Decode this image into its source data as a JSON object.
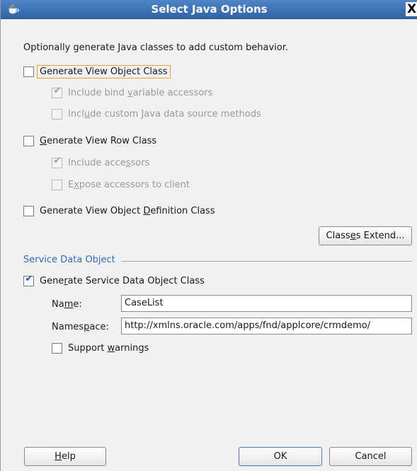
{
  "window": {
    "title": "Select Java Options",
    "close_glyph": "X",
    "icon": "java-cup-icon"
  },
  "intro": "Optionally generate Java classes to add custom behavior.",
  "view_object_class": {
    "label_pre": "Generate View Ob",
    "label_key": "j",
    "label_post": "ect Class",
    "checked": false
  },
  "bind_accessors": {
    "label_pre": "Include bind ",
    "label_key": "v",
    "label_post": "ariable accessors",
    "checked": true
  },
  "custom_methods": {
    "label_pre": "Incl",
    "label_key": "u",
    "label_post": "de custom Java data source methods",
    "checked": false
  },
  "view_row_class": {
    "label_pre": "",
    "label_key": "G",
    "label_post": "enerate View Row Class",
    "checked": false
  },
  "row_accessors": {
    "label_pre": "Include acce",
    "label_key": "s",
    "label_post": "sors",
    "checked": true
  },
  "expose_accessors": {
    "label_pre": "E",
    "label_key": "x",
    "label_post": "pose accessors to client",
    "checked": false
  },
  "definition_class": {
    "label_pre": "Generate View Object ",
    "label_key": "D",
    "label_post": "efinition Class",
    "checked": false
  },
  "classes_extend": {
    "label_pre": "Class",
    "label_key": "e",
    "label_post": "s Extend..."
  },
  "sdo": {
    "section_title": "Service Data Object",
    "generate_pre": "Gene",
    "generate_key": "r",
    "generate_post": "ate Service Data Object Class",
    "generate_checked": true,
    "name_label_pre": "Na",
    "name_label_key": "m",
    "name_label_post": "e:",
    "name_value": "CaseList",
    "namespace_label_pre": "Names",
    "namespace_label_key": "p",
    "namespace_label_post": "ace:",
    "namespace_value": "http://xmlns.oracle.com/apps/fnd/applcore/crmdemo/",
    "warnings_pre": "Support ",
    "warnings_key": "w",
    "warnings_post": "arnings",
    "warnings_checked": false
  },
  "buttons": {
    "help_key": "H",
    "help_post": "elp",
    "ok": "OK",
    "cancel": "Cancel"
  },
  "check_glyph": "✔",
  "colors": {
    "titlebar": "#3a70b8",
    "section_title": "#2f6bc0",
    "focus_outline": "#f0a030"
  }
}
